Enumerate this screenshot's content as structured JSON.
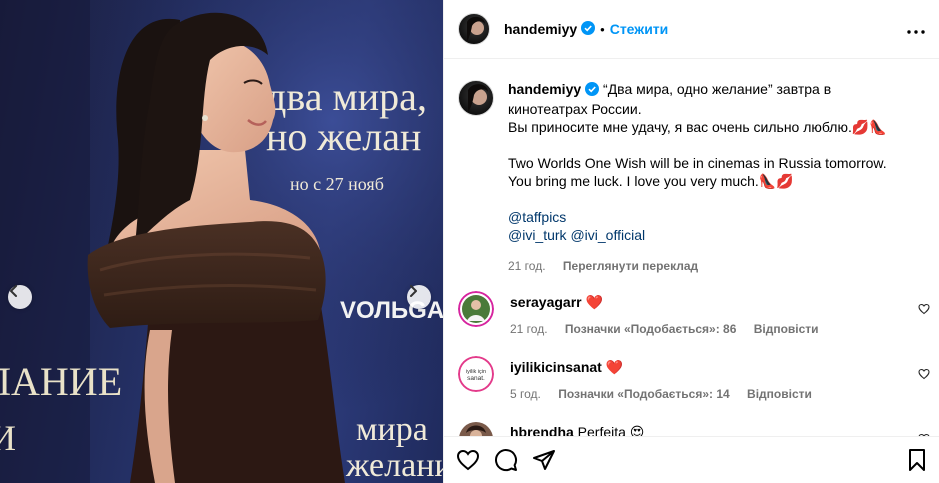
{
  "photo": {
    "banner_lines": [
      "два мира,",
      "но желан",
      "но с 27 нояб"
    ],
    "brand": "VОЛЬGA",
    "banner_bottom": [
      "мира",
      "желание"
    ],
    "left_edge_text": [
      "ЕЛАНИЕ",
      "И"
    ]
  },
  "header": {
    "username": "handemiyy",
    "separator": "•",
    "follow_label": "Стежити"
  },
  "caption": {
    "username": "handemiyy",
    "line1": "“Два мира, одно желание” завтра в кинотеатрах России.",
    "line2": "Вы приносите мне удачу, я вас очень сильно люблю.💋👠",
    "line3": "Two Worlds One Wish will be in cinemas in Russia tomorrow.",
    "line4": "You bring me luck. I love you very much.👠💋",
    "mention1": "@taffpics",
    "mention2": "@ivi_turk",
    "mention3": "@ivi_official",
    "time": "21 год.",
    "translate_label": "Переглянути переклад"
  },
  "comments": [
    {
      "username": "serayagarr",
      "text": "❤️",
      "time": "21 год.",
      "likes": "Позначки «Подобається»: 86",
      "reply": "Відповісти",
      "avatar_color": "#4a7a3a"
    },
    {
      "username": "iyilikicinsanat",
      "text": "❤️",
      "time": "5 год.",
      "likes": "Позначки «Подобається»: 14",
      "reply": "Відповісти",
      "avatar_color": "#e33a8a",
      "avatar_text": "iyilik için sanat."
    },
    {
      "username": "hbrendha",
      "text": "Perfeita 😍",
      "avatar_color": "#7a5a4a"
    }
  ],
  "icons": [
    "chevron-left-icon",
    "chevron-right-icon",
    "verified-badge-icon",
    "more-horizontal-icon",
    "heart-icon",
    "comment-icon",
    "share-icon",
    "bookmark-icon"
  ],
  "colors": {
    "accent": "#0095f6",
    "verified": "#0095f6",
    "mention": "#00376b",
    "muted": "#737373",
    "like_red": "#ed1c24"
  }
}
